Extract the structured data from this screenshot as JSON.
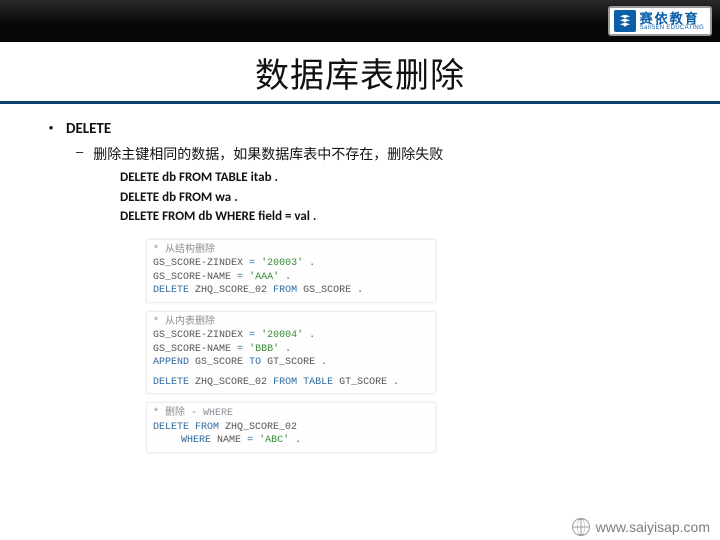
{
  "logo": {
    "cn": "赛依教育",
    "en": "SaiISEN EDUCATING"
  },
  "title": "数据库表删除",
  "bullet": {
    "l1": "DELETE",
    "l2": "删除主键相同的数据，如果数据库表中不存在，删除失败",
    "code1": "DELETE db FROM TABLE itab .",
    "code2": "DELETE db FROM wa .",
    "code3": "DELETE FROM db WHERE field = val ."
  },
  "snips": {
    "s1": {
      "c": "* 从结构删除",
      "l1a": "GS_SCORE-ZINDEX",
      "l1b": "=",
      "l1c": "'20003'",
      "l1d": ".",
      "l2a": "GS_SCORE-NAME",
      "l2b": "=",
      "l2c": "'AAA'",
      "l2d": ".",
      "l3a": "DELETE",
      "l3b": "ZHQ_SCORE_02",
      "l3c": "FROM",
      "l3d": "GS_SCORE ."
    },
    "s2": {
      "c": "* 从内表删除",
      "l1a": "GS_SCORE-ZINDEX",
      "l1b": "=",
      "l1c": "'20004'",
      "l1d": ".",
      "l2a": "GS_SCORE-NAME",
      "l2b": "=",
      "l2c": "'BBB'",
      "l2d": ".",
      "l3a": "APPEND",
      "l3b": "GS_SCORE",
      "l3c": "TO",
      "l3d": "GT_SCORE .",
      "l4a": "DELETE",
      "l4b": "ZHQ_SCORE_02",
      "l4c": "FROM TABLE",
      "l4d": "GT_SCORE ."
    },
    "s3": {
      "c": "* 删除 - WHERE",
      "l1a": "DELETE FROM",
      "l1b": "ZHQ_SCORE_02",
      "l2a": "WHERE",
      "l2b": "NAME",
      "l2c": "=",
      "l2d": "'ABC'",
      "l2e": "."
    }
  },
  "footer": {
    "url": "www.saiyisap.com"
  }
}
